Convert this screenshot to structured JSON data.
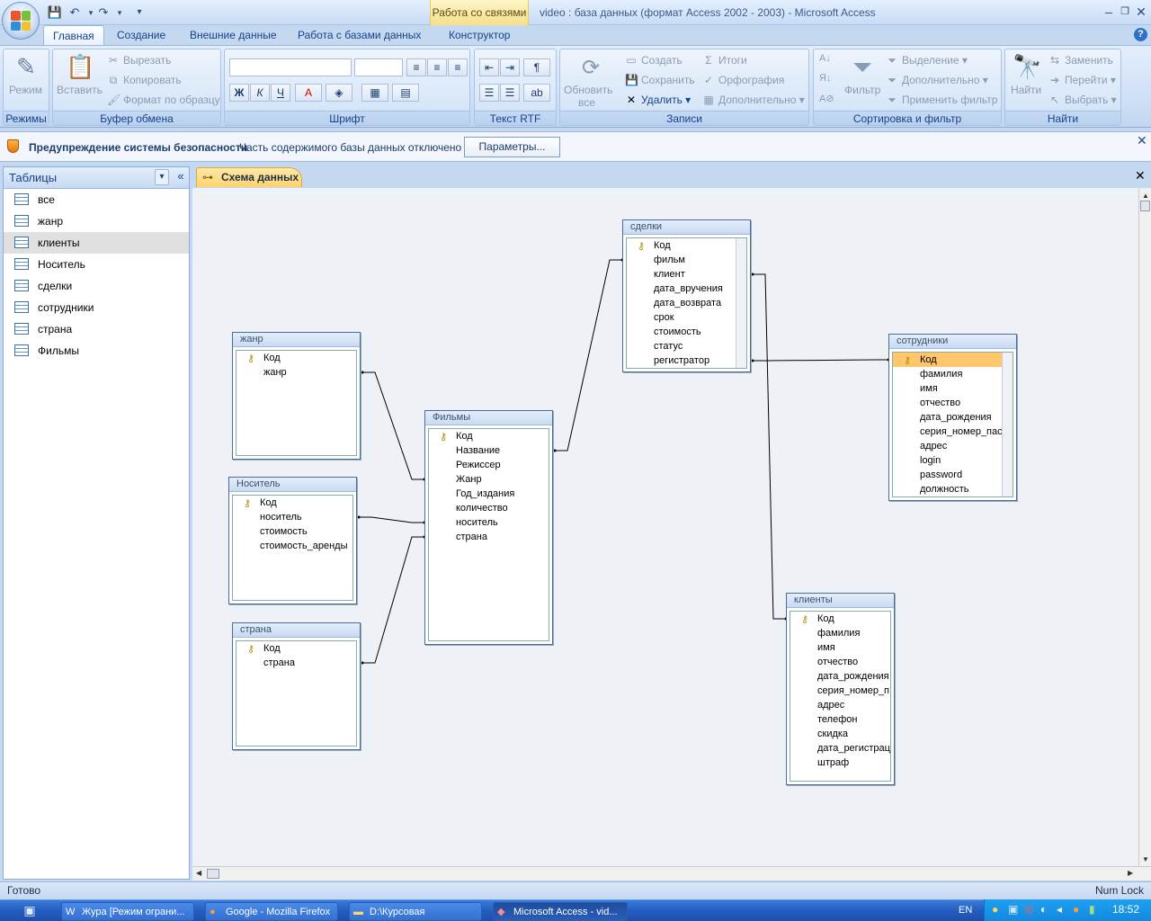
{
  "window": {
    "context_tab": "Работа со связями",
    "title": "video : база данных (формат Access 2002 - 2003) - Microsoft Access"
  },
  "ribbon_tabs": [
    "Главная",
    "Создание",
    "Внешние данные",
    "Работа с базами данных",
    "Конструктор"
  ],
  "ribbon": {
    "modes": {
      "label": "Режимы",
      "view": "Режим"
    },
    "clipboard": {
      "label": "Буфер обмена",
      "paste": "Вставить",
      "cut": "Вырезать",
      "copy": "Копировать",
      "format_painter": "Формат по образцу"
    },
    "font": {
      "label": "Шрифт",
      "bold": "Ж",
      "italic": "К",
      "underline": "Ч"
    },
    "rtf": {
      "label": "Текст RTF"
    },
    "records": {
      "label": "Записи",
      "refresh": "Обновить",
      "refresh2": "все",
      "new": "Создать",
      "save": "Сохранить",
      "delete": "Удалить",
      "totals": "Итоги",
      "spelling": "Орфография",
      "more": "Дополнительно"
    },
    "sort_filter": {
      "label": "Сортировка и фильтр",
      "filter": "Фильтр",
      "selection": "Выделение",
      "advanced": "Дополнительно",
      "toggle": "Применить фильтр"
    },
    "find": {
      "label": "Найти",
      "find": "Найти",
      "replace": "Заменить",
      "goto": "Перейти",
      "select": "Выбрать"
    }
  },
  "security_bar": {
    "title": "Предупреждение системы безопасности",
    "message": "Часть содержимого базы данных отключено",
    "button": "Параметры..."
  },
  "nav_pane": {
    "header": "Таблицы",
    "items": [
      "все",
      "жанр",
      "клиенты",
      "Носитель",
      "сделки",
      "сотрудники",
      "страна",
      "Фильмы"
    ],
    "selected": "клиенты"
  },
  "document_tab": "Схема данных",
  "diagram": {
    "tables": {
      "zhanr": {
        "title": "жанр",
        "fields": [
          "Код",
          "жанр"
        ]
      },
      "nositel": {
        "title": "Носитель",
        "fields": [
          "Код",
          "носитель",
          "стоимость",
          "стоимость_аренды"
        ]
      },
      "strana": {
        "title": "страна",
        "fields": [
          "Код",
          "страна"
        ]
      },
      "filmy": {
        "title": "Фильмы",
        "fields": [
          "Код",
          "Название",
          "Режиссер",
          "Жанр",
          "Год_издания",
          "количество",
          "носитель",
          "страна"
        ]
      },
      "sdelki": {
        "title": "сделки",
        "fields": [
          "Код",
          "фильм",
          "клиент",
          "дата_вручения",
          "дата_возврата",
          "срок",
          "стоимость",
          "статус",
          "регистратор"
        ]
      },
      "sotrudniki": {
        "title": "сотрудники",
        "fields": [
          "Код",
          "фамилия",
          "имя",
          "отчество",
          "дата_рождения",
          "серия_номер_пас",
          "адрес",
          "login",
          "password",
          "должность"
        ]
      },
      "klienty": {
        "title": "клиенты",
        "fields": [
          "Код",
          "фамилия",
          "имя",
          "отчество",
          "дата_рождения",
          "серия_номер_п",
          "адрес",
          "телефон",
          "скидка",
          "дата_регистрац",
          "штраф"
        ]
      }
    }
  },
  "status": {
    "left": "Готово",
    "right": "Num Lock"
  },
  "taskbar": {
    "items": [
      "Жура [Режим ограни...",
      "Google - Mozilla Firefox",
      "D:\\Курсовая",
      "Microsoft Access - vid..."
    ],
    "lang": "EN",
    "clock": "18:52"
  }
}
